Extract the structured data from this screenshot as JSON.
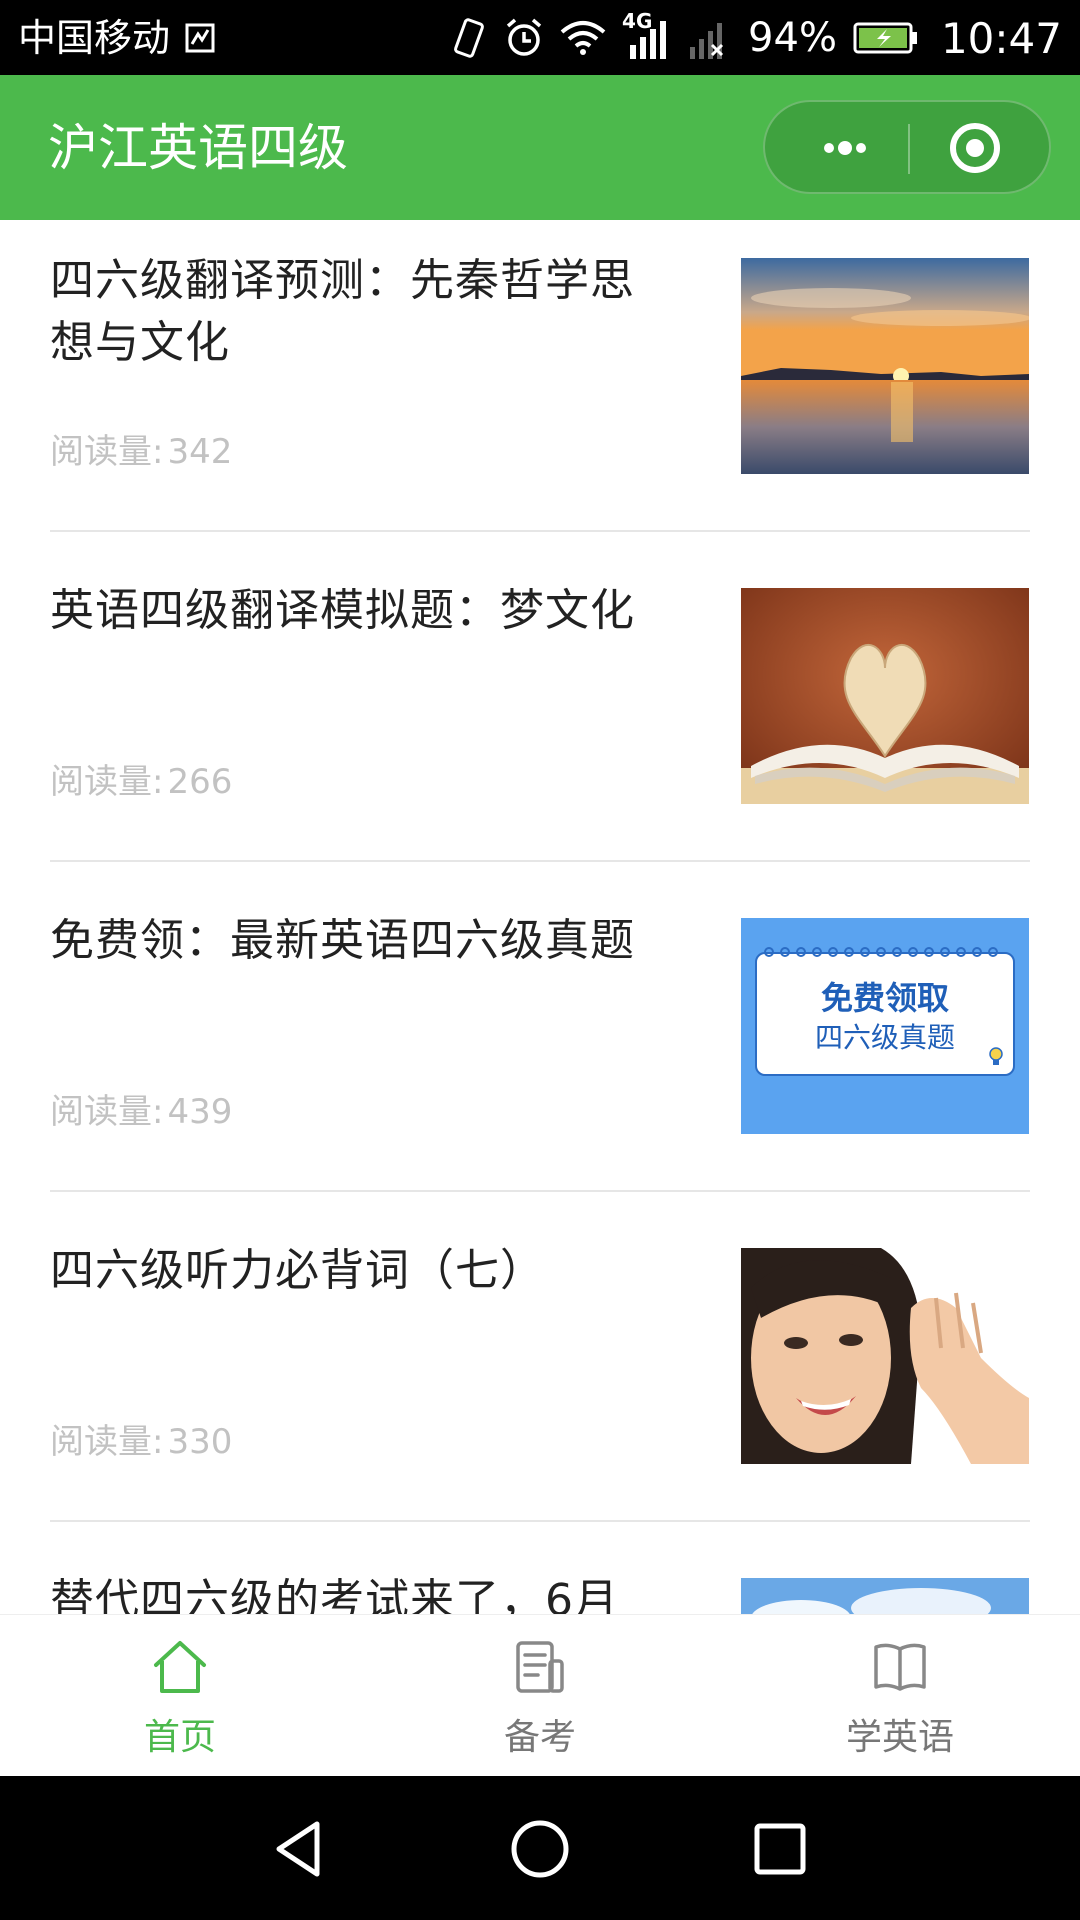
{
  "status_bar": {
    "carrier": "中国移动",
    "network": "4G",
    "battery": "94%",
    "time": "10:47",
    "icons": [
      "sim-icon",
      "vibrate-icon",
      "alarm-icon",
      "wifi-icon",
      "signal-icon",
      "no-signal-icon",
      "battery-icon"
    ]
  },
  "header": {
    "title": "沪江英语四级",
    "menu_icon": "more-dots-icon",
    "close_icon": "target-close-icon"
  },
  "articles": [
    {
      "title": "四六级翻译预测：先秦哲学思想与文化",
      "meta_label": "阅读量:",
      "count": "342",
      "image": "sunset-lake"
    },
    {
      "title": "英语四级翻译模拟题：梦文化",
      "meta_label": "阅读量:",
      "count": "266",
      "image": "heart-book"
    },
    {
      "title": "免费领：最新英语四六级真题",
      "meta_label": "阅读量:",
      "count": "439",
      "image": "free-exam-banner",
      "image_text": [
        "免费领取",
        "四六级真题"
      ]
    },
    {
      "title": "四六级听力必背词（七）",
      "meta_label": "阅读量:",
      "count": "330",
      "image": "listening-woman"
    },
    {
      "title": "替代四六级的考试来了，6月",
      "image": "blue-sky"
    }
  ],
  "tabs": [
    {
      "label": "首页",
      "icon": "home-icon",
      "active": true
    },
    {
      "label": "备考",
      "icon": "notes-icon",
      "active": false
    },
    {
      "label": "学英语",
      "icon": "book-icon",
      "active": false
    }
  ],
  "colors": {
    "brand": "#4cb94c",
    "title_text": "#222222",
    "meta_text": "#c2c2c2",
    "inactive_tab": "#777777"
  }
}
